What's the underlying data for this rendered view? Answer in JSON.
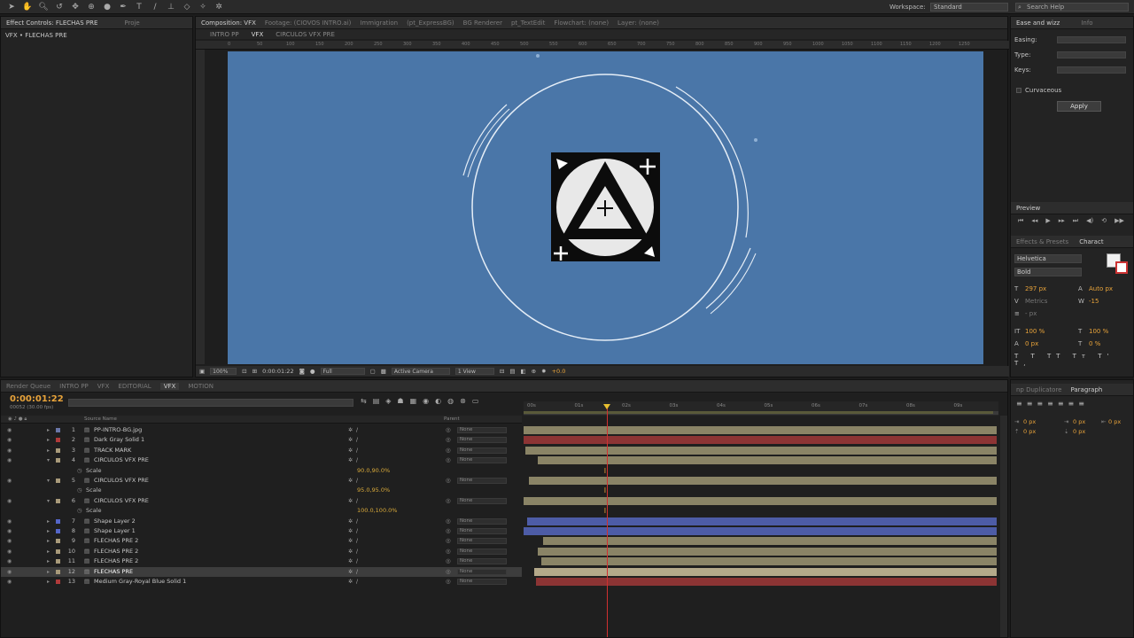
{
  "toolbar": {
    "workspace_label": "Workspace:",
    "workspace_value": "Standard",
    "search_placeholder": "Search Help"
  },
  "left_panel": {
    "tabs": [
      "Effect Controls: FLECHAS PRE",
      "Proje"
    ],
    "breadcrumb": "VFX • FLECHAS PRE"
  },
  "comp_panel": {
    "tabs": [
      "Composition: VFX",
      "Footage: (CIOVOS INTRO.ai)",
      "Immigration",
      "(pt_ExpressBG)",
      "BG Renderer",
      "pt_TextEdit",
      "Flowchart: (none)",
      "Layer: (none)"
    ],
    "breadcrumbs": [
      "INTRO PP",
      "VFX",
      "CIRCULOS VFX PRE"
    ],
    "ruler_ticks": [
      "0",
      "50",
      "100",
      "150",
      "200",
      "250",
      "300",
      "350",
      "400",
      "450",
      "500",
      "550",
      "600",
      "650",
      "700",
      "750",
      "800",
      "850",
      "900",
      "950",
      "1000",
      "1050",
      "1100",
      "1150",
      "1200",
      "1250"
    ],
    "zoom": "100%",
    "timecode": "0:00:01:22",
    "resolution": "Full",
    "camera": "Active Camera",
    "view": "1 View",
    "exposure": "+0.0"
  },
  "right_panel": {
    "ease_tabs": [
      "Ease and wizz",
      "Info"
    ],
    "easing_label": "Easing:",
    "type_label": "Type:",
    "keys_label": "Keys:",
    "curvaceous_label": "Curvaceous",
    "apply_label": "Apply",
    "preview_tab": "Preview",
    "effects_tabs": [
      "Effects & Presets",
      "Charact"
    ],
    "font_family": "Helvetica",
    "font_style": "Bold",
    "font_size": "297 px",
    "leading": "Auto px",
    "kerning": "Metrics",
    "tracking": "-15",
    "stroke_width": "- px",
    "vscale": "100 %",
    "hscale": "100 %",
    "baseline": "0 px",
    "tsume": "0 %",
    "para_tabs": [
      "np Duplicatore",
      "Paragraph"
    ],
    "indent_values": [
      "0 px",
      "0 px",
      "0 px",
      "0 px",
      "0 px"
    ]
  },
  "timeline": {
    "tabs": [
      "Render Queue",
      "INTRO PP",
      "VFX",
      "EDITORIAL",
      "VFX",
      "MOTION"
    ],
    "active_tab_index": 4,
    "timecode": "0:00:01:22",
    "frame_info": "00052 (30.00 fps)",
    "column_source": "Source Name",
    "column_parent": "Parent",
    "time_ticks": [
      "00s",
      "01s",
      "02s",
      "03s",
      "04s",
      "05s",
      "06s",
      "07s",
      "08s",
      "09s"
    ],
    "playhead_fraction": 0.175,
    "layers": [
      {
        "num": "1",
        "name": "PP-INTRO-BG.jpg",
        "color": "#6a76a8",
        "parent": "None",
        "expanded": false
      },
      {
        "num": "2",
        "name": "Dark Gray Solid 1",
        "color": "#b03a3a",
        "parent": "None",
        "expanded": false
      },
      {
        "num": "3",
        "name": "TRACK MARK",
        "color": "#a89a7a",
        "parent": "None",
        "expanded": false
      },
      {
        "num": "4",
        "name": "CIRCULOS VFX PRE",
        "color": "#a89a7a",
        "parent": "None",
        "expanded": true,
        "prop": "Scale",
        "value": "90.0,90.0%"
      },
      {
        "num": "5",
        "name": "CIRCULOS VFX PRE",
        "color": "#a89a7a",
        "parent": "None",
        "expanded": true,
        "prop": "Scale",
        "value": "95.0,95.0%"
      },
      {
        "num": "6",
        "name": "CIRCULOS VFX PRE",
        "color": "#a89a7a",
        "parent": "None",
        "expanded": true,
        "prop": "Scale",
        "value": "100.0,100.0%"
      },
      {
        "num": "7",
        "name": "Shape Layer 2",
        "color": "#5566c8",
        "parent": "None",
        "expanded": false
      },
      {
        "num": "8",
        "name": "Shape Layer 1",
        "color": "#5566c8",
        "parent": "None",
        "expanded": false
      },
      {
        "num": "9",
        "name": "FLECHAS PRE 2",
        "color": "#a89a7a",
        "parent": "None",
        "expanded": false
      },
      {
        "num": "10",
        "name": "FLECHAS PRE 2",
        "color": "#a89a7a",
        "parent": "None",
        "expanded": false
      },
      {
        "num": "11",
        "name": "FLECHAS PRE 2",
        "color": "#a89a7a",
        "parent": "None",
        "expanded": false
      },
      {
        "num": "12",
        "name": "FLECHAS PRE",
        "color": "#a89a7a",
        "parent": "None",
        "expanded": false,
        "selected": true
      },
      {
        "num": "13",
        "name": "Medium Gray-Royal Blue Solid 1",
        "color": "#b03a3a",
        "parent": "None",
        "expanded": false
      }
    ]
  },
  "colors": {
    "canvas_blue": "#4a76a8",
    "accent_orange": "#e8a33a",
    "bar_tan": "#8a8466",
    "bar_red": "#8c3434",
    "bar_blue": "#4d5ca6"
  }
}
